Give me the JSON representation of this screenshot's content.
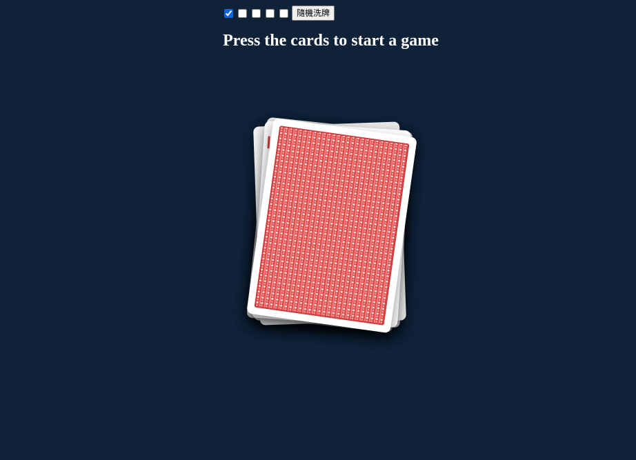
{
  "controls": {
    "checkboxes": [
      {
        "checked": true
      },
      {
        "checked": false
      },
      {
        "checked": false
      },
      {
        "checked": false
      },
      {
        "checked": false
      }
    ],
    "shuffle_button_label": "隨機洗牌"
  },
  "headline": "Press the cards to start a game",
  "colors": {
    "background": "#0f2238",
    "card_back": "#e14b4b",
    "card_border": "#ffffff"
  },
  "deck": {
    "card_count_visible": 5,
    "top_card_face": "back"
  }
}
